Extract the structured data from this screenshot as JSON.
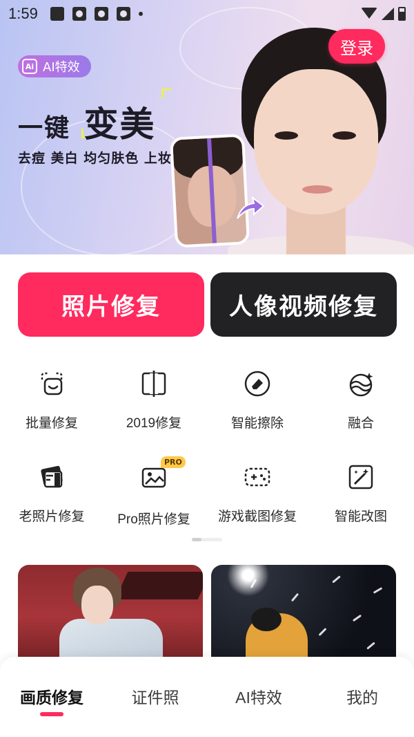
{
  "status_bar": {
    "time": "1:59"
  },
  "banner": {
    "login_label": "登录",
    "ai_tag_icon_text": "Ai",
    "ai_tag_label": "AI特效",
    "title_small": "一键",
    "title_large": "变美",
    "subtitle": "去痘 美白 均匀肤色 上妆"
  },
  "main_buttons": {
    "photo_repair": "照片修复",
    "video_repair": "人像视频修复"
  },
  "functions": [
    {
      "label": "批量修复",
      "icon": "batch-repair-icon"
    },
    {
      "label": "2019修复",
      "icon": "split-frame-icon"
    },
    {
      "label": "智能擦除",
      "icon": "eraser-icon"
    },
    {
      "label": "融合",
      "icon": "blend-waves-icon"
    },
    {
      "label": "老照片修复",
      "icon": "old-photo-icon"
    },
    {
      "label": "Pro照片修复",
      "icon": "pro-photo-icon",
      "badge": "PRO"
    },
    {
      "label": "游戏截图修复",
      "icon": "gamepad-icon"
    },
    {
      "label": "智能改图",
      "icon": "magic-edit-icon"
    }
  ],
  "bottom_nav": {
    "tabs": [
      "画质修复",
      "证件照",
      "AI特效",
      "我的"
    ],
    "active_index": 0
  },
  "colors": {
    "accent": "#ff2a5e",
    "dark_button": "#222224",
    "pro_badge": "#ffc94a"
  }
}
